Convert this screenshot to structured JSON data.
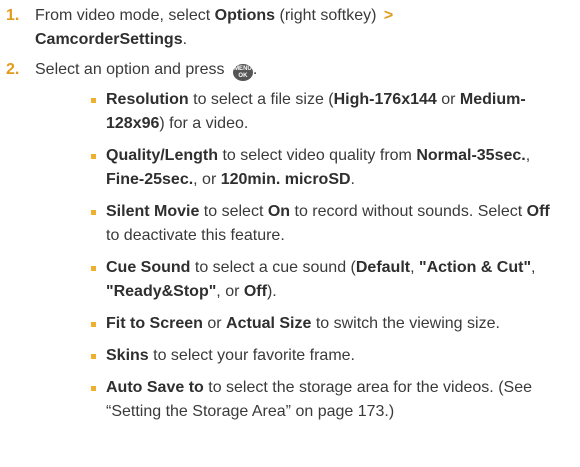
{
  "steps": [
    {
      "num": "1.",
      "t1": "From video mode, select ",
      "b1": "Options",
      "t2": " (right softkey) ",
      "chev": ">",
      "b2": "CamcorderSettings",
      "t3": "."
    },
    {
      "num": "2.",
      "t1": "Select an option and press ",
      "key_top": "MENU",
      "key_bottom": "OK",
      "t2": "."
    }
  ],
  "options": [
    {
      "name": "Resolution",
      "t1": " to select a file size (",
      "b1": "High-176x144",
      "t2": " or ",
      "b2": "Medium-128x96",
      "t3": ") for a video."
    },
    {
      "name": "Quality/Length",
      "t1": " to select video quality from ",
      "b1": "Normal-35sec.",
      "t2": ", ",
      "b2": "Fine-25sec.",
      "t3": ", or ",
      "b3": "120min. microSD",
      "t4": "."
    },
    {
      "name": "Silent Movie",
      "t1": " to select ",
      "b1": "On",
      "t2": " to record without sounds. Select ",
      "b2": "Off",
      "t3": " to deactivate this feature."
    },
    {
      "name": "Cue Sound",
      "t1": " to select a cue sound (",
      "b1": "Default",
      "t2": ", ",
      "b2": "\"Action & Cut\"",
      "t3": ", ",
      "b3": "\"Ready&Stop\"",
      "t4": ", or ",
      "b4": "Off",
      "t5": ")."
    },
    {
      "name": "Fit to Screen",
      "t1": " or ",
      "b1": "Actual Size",
      "t2": " to switch the viewing size."
    },
    {
      "name": "Skins",
      "t1": " to select your favorite frame."
    },
    {
      "name": "Auto Save to",
      "t1": " to select the storage area for the videos. (See “Setting the Storage Area” on page 173.)"
    }
  ],
  "colors": {
    "accent": "#e29a1d",
    "bullet": "#f0b02d",
    "text": "#3a3a3a",
    "key_icon": "#555555"
  },
  "icons": {
    "menu_ok_key": "menu-ok-key-icon"
  }
}
